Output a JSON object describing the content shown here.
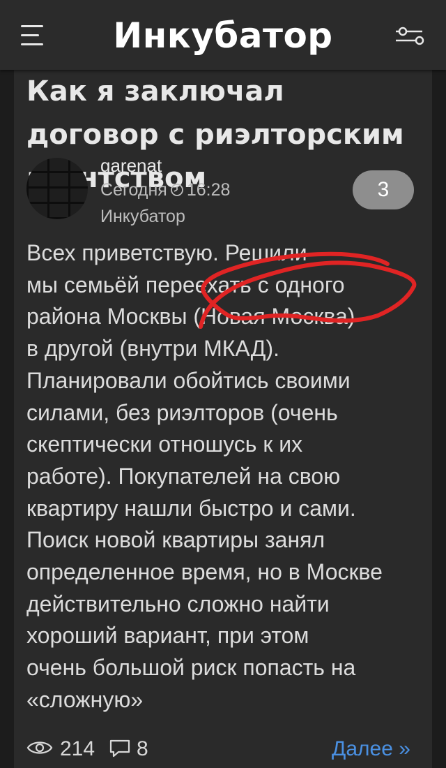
{
  "header": {
    "title": "Инкубатор",
    "menu_icon": "hamburger-menu-icon",
    "filter_icon": "sliders-filter-icon"
  },
  "post": {
    "title": "Как я заключал договор с риэлторским агентством",
    "author": "garenat",
    "time_label": "Сегодня",
    "time": "16:28",
    "community": "Инкубатор",
    "rating": "3",
    "body": "Всех приветствую. Решили\nмы семьёй переехать с одного\nрайона Москвы (Новая Москва)\nв другой (внутри МКАД).\nПланировали обойтись своими\nсилами, без риэлторов (очень\nскептически отношусь к их\nработе). Покупателей на свою\nквартиру нашли быстро и сами.\nПоиск новой квартиры занял\nопределенное время, но в Москве\nдействительно сложно найти\nхороший вариант, при этом\nочень большой риск попасть на\n«сложную»"
  },
  "footer": {
    "views": "214",
    "comments": "8",
    "more_label": "Далее »"
  },
  "colors": {
    "background": "#1c1c1c",
    "topbar": "#2b2b2b",
    "card": "#2a2a2a",
    "link": "#4a90e2",
    "badge": "#8e8e8e",
    "scribble": "#e02424"
  }
}
